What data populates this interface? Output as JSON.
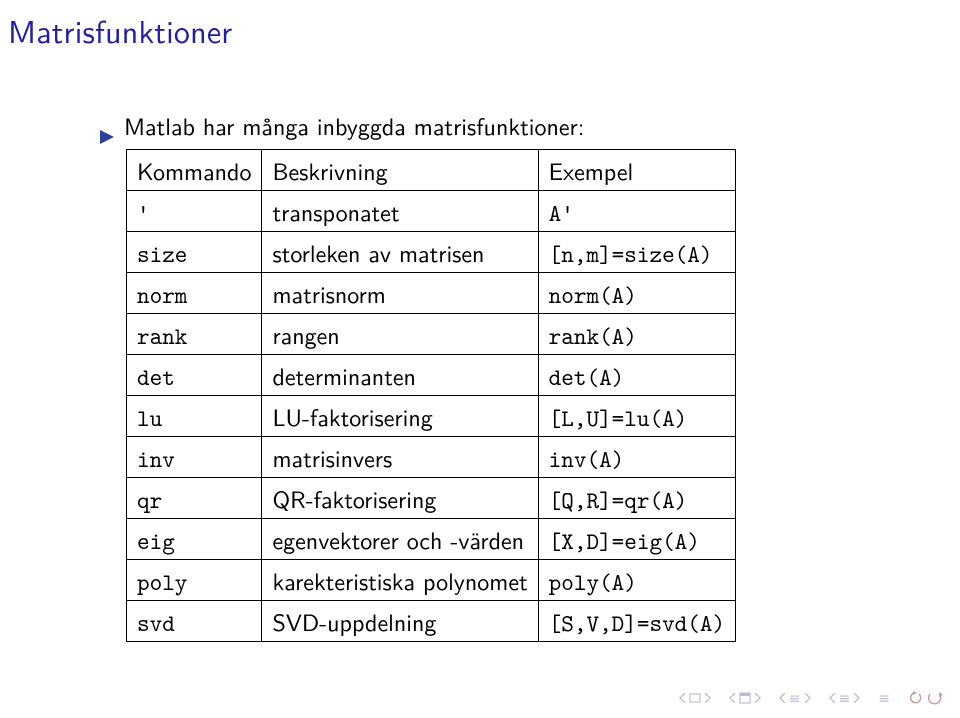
{
  "title": "Matrisfunktioner",
  "bullet": "Matlab har många inbyggda matrisfunktioner:",
  "table": {
    "headers": [
      "Kommando",
      "Beskrivning",
      "Exempel"
    ],
    "rows": [
      {
        "cmd": "'",
        "desc": "transponatet",
        "ex": "A'"
      },
      {
        "cmd": "size",
        "desc": "storleken av matrisen",
        "ex": "[n,m]=size(A)"
      },
      {
        "cmd": "norm",
        "desc": "matrisnorm",
        "ex": "norm(A)"
      },
      {
        "cmd": "rank",
        "desc": "rangen",
        "ex": "rank(A)"
      },
      {
        "cmd": "det",
        "desc": "determinanten",
        "ex": "det(A)"
      },
      {
        "cmd": "lu",
        "desc": "LU-faktorisering",
        "ex": "[L,U]=lu(A)"
      },
      {
        "cmd": "inv",
        "desc": "matrisinvers",
        "ex": "inv(A)"
      },
      {
        "cmd": "qr",
        "desc": "QR-faktorisering",
        "ex": "[Q,R]=qr(A)"
      },
      {
        "cmd": "eig",
        "desc": "egenvektorer och -värden",
        "ex": "[X,D]=eig(A)"
      },
      {
        "cmd": "poly",
        "desc": "karekteristiska polynomet",
        "ex": "poly(A)"
      },
      {
        "cmd": "svd",
        "desc": "SVD-uppdelning",
        "ex": "[S,V,D]=svd(A)"
      }
    ]
  },
  "icons": {
    "triangle": "▶",
    "equiv": "≡"
  }
}
